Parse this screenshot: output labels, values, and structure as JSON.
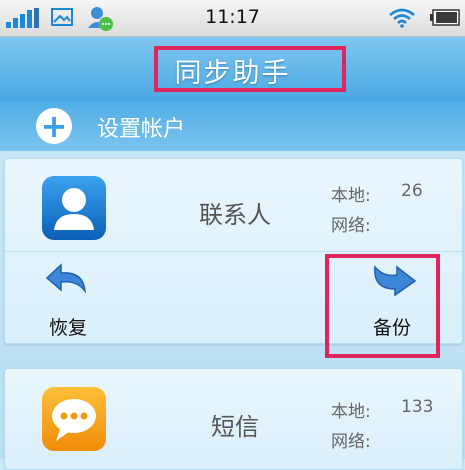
{
  "status_bar": {
    "time": "11:17",
    "icons": [
      "signal-icon",
      "image-icon",
      "chat-avatar-icon",
      "wifi-icon",
      "battery-icon"
    ]
  },
  "header": {
    "title": "同步助手"
  },
  "setup": {
    "label": "设置帐户",
    "icon": "plus-icon"
  },
  "cards": [
    {
      "name": "联系人",
      "icon": "contacts-icon",
      "local_label": "本地:",
      "local_value": "26",
      "network_label": "网络:",
      "network_value": "",
      "actions": [
        {
          "label": "恢复",
          "icon": "restore-arrow-icon"
        },
        {
          "label": "备份",
          "icon": "backup-arrow-icon"
        }
      ]
    },
    {
      "name": "短信",
      "icon": "sms-icon",
      "local_label": "本地:",
      "local_value": "133",
      "network_label": "网络:",
      "network_value": ""
    }
  ],
  "colors": {
    "header": "#4aa9e2",
    "highlight": "#e0245e",
    "contacts_icon": "#1f7fd6",
    "sms_icon": "#f6a21a"
  }
}
